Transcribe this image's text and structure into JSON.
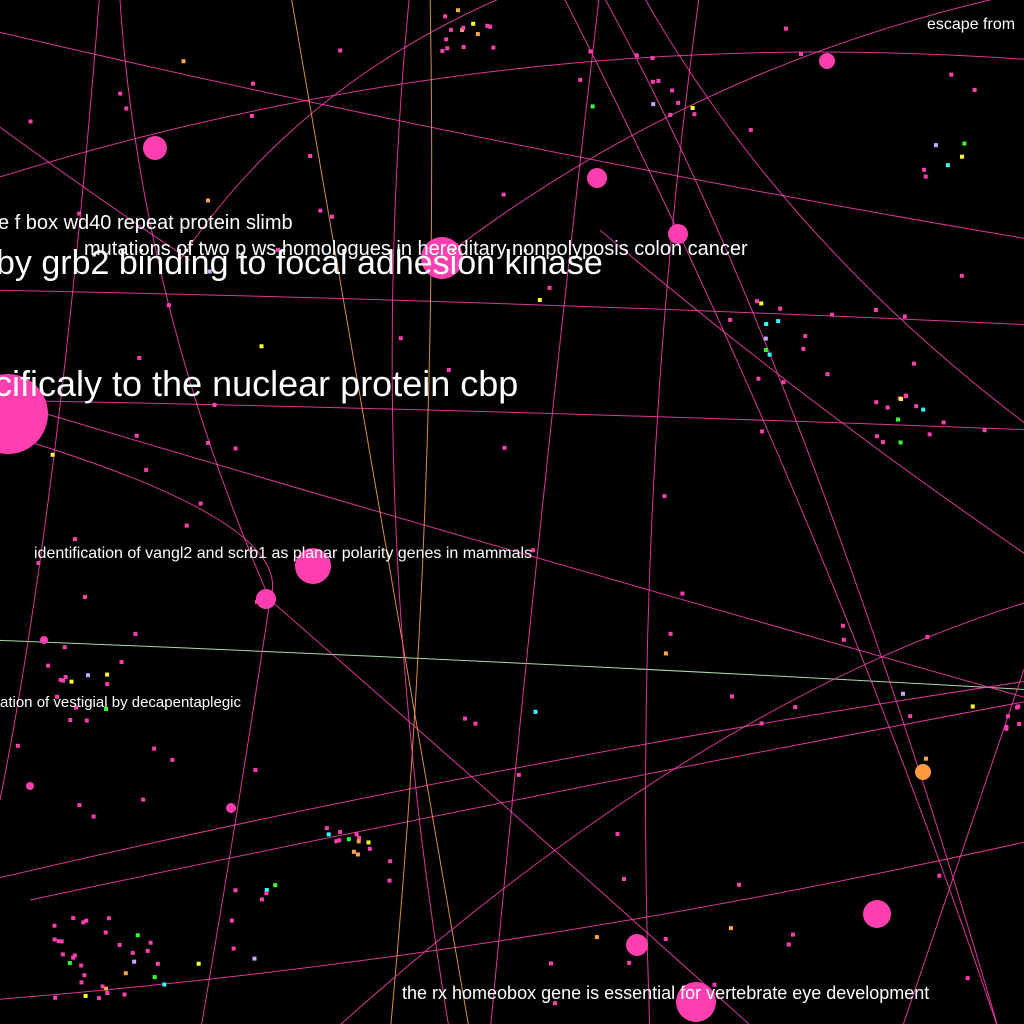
{
  "colors": {
    "background": "#000000",
    "edge": "#ff3fb0",
    "edge_alt": "#ffa64d",
    "edge_pale": "#ccffcc",
    "node": "#ff3fb0",
    "node_orange": "#ff9a40",
    "dot_colors": [
      "#ff3fb0",
      "#ffa64d",
      "#33ff33",
      "#ffff33",
      "#33ffff",
      "#c8a8ff"
    ],
    "label": "#ffffff"
  },
  "labels": [
    {
      "key": "cbp",
      "text": "cificaly to the nuclear protein cbp"
    },
    {
      "key": "fak",
      "text": "by grb2 binding to focal adhesion kinase"
    },
    {
      "key": "slimb",
      "text": "e f box wd40 repeat protein slimb"
    },
    {
      "key": "hnpcc",
      "text": "mutations of two p ws homologues in hereditary nonpolyposis colon cancer"
    },
    {
      "key": "vangl2",
      "text": "identification of vangl2 and scrb1 as planar polarity genes in mammals"
    },
    {
      "key": "vestigial",
      "text": "ation of vestigial by decapentaplegic"
    },
    {
      "key": "rx",
      "text": "the rx homeobox gene is essential for vertebrate eye development"
    },
    {
      "key": "escape",
      "text": "escape from"
    }
  ]
}
